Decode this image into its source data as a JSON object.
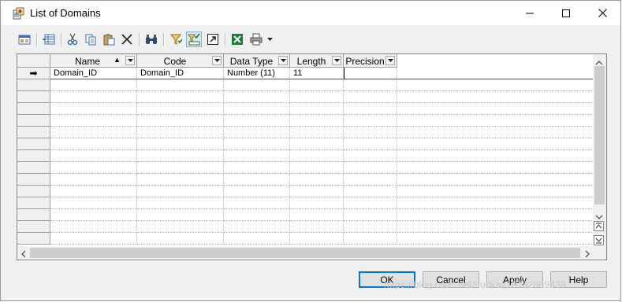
{
  "window": {
    "title": "List of Domains"
  },
  "icons": {
    "app": "domain-list-icon",
    "toolbar": [
      "properties-icon",
      "add-row-icon",
      "cut-icon",
      "copy-icon",
      "paste-icon",
      "delete-icon",
      "find-icon",
      "filter-icon",
      "column-filter-icon",
      "open-icon",
      "excel-export-icon",
      "print-icon",
      "dropdown-arrow-icon"
    ]
  },
  "table": {
    "columns": [
      {
        "label": "Name",
        "sort": "▲"
      },
      {
        "label": "Code"
      },
      {
        "label": "Data Type"
      },
      {
        "label": "Length"
      },
      {
        "label": "Precision"
      }
    ],
    "rows": [
      {
        "indicator": "➡",
        "name": "Domain_ID",
        "code": "Domain_ID",
        "data_type": "Number (11)",
        "length": "11",
        "precision": ""
      }
    ]
  },
  "buttons": {
    "ok": "OK",
    "cancel": "Cancel",
    "apply": "Apply",
    "help": "Help"
  },
  "watermark": "https://blog.csdn.net/hudkai/18792869839",
  "colors": {
    "selection_border": "#0078d7",
    "grid_border": "#828790"
  }
}
